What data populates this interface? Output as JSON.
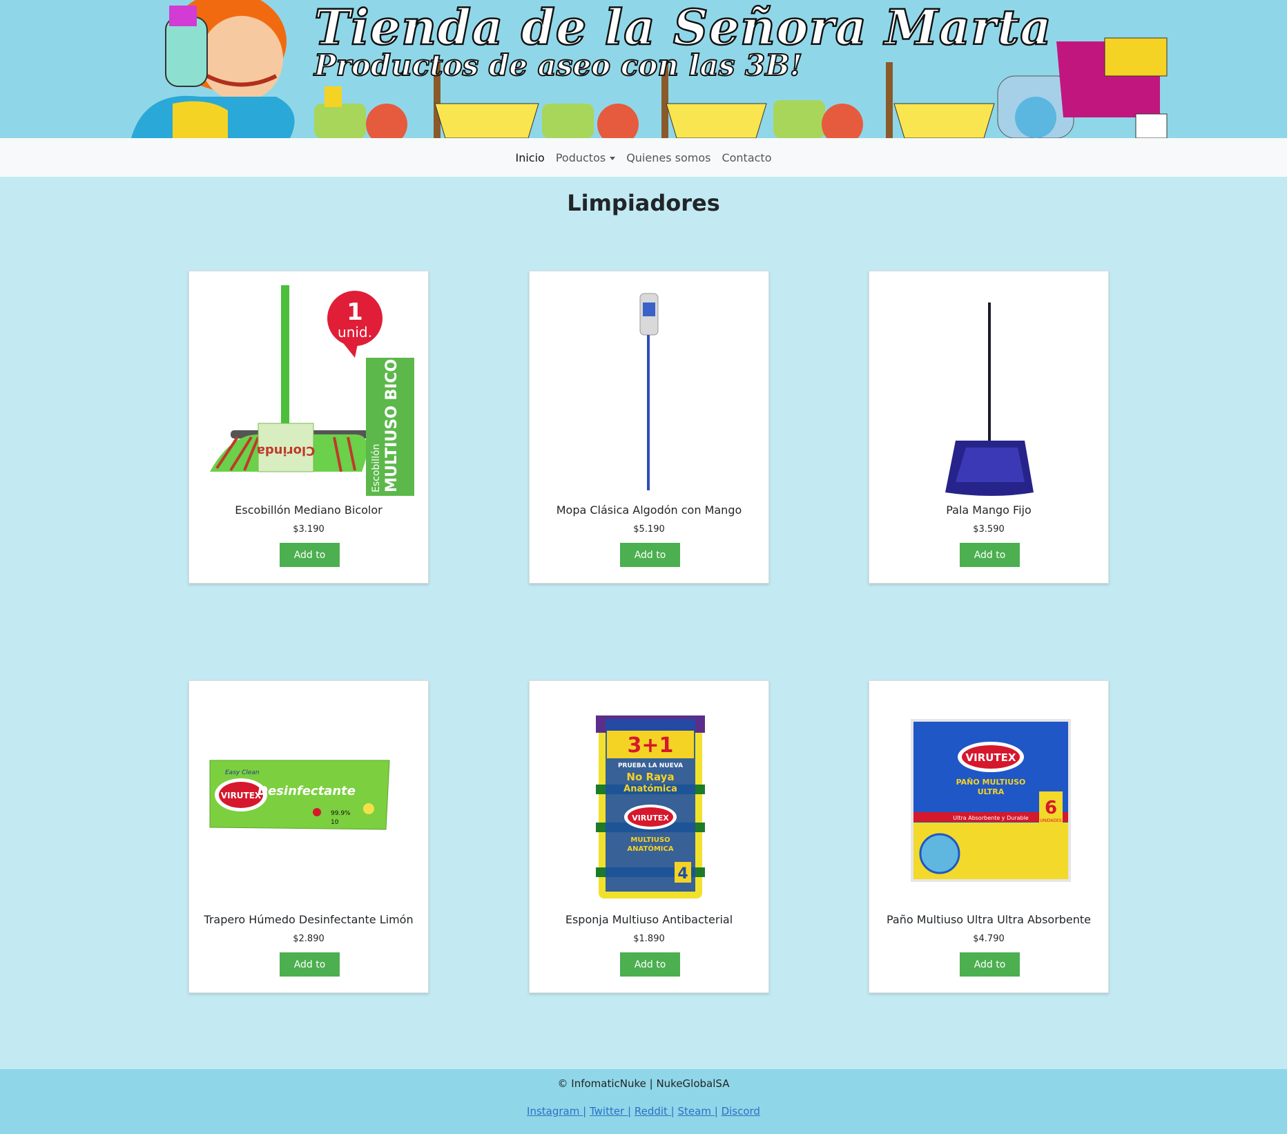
{
  "banner": {
    "title": "Tienda de la Señora Marta",
    "subtitle": "Productos de aseo con las 3B!"
  },
  "nav": {
    "items": [
      {
        "label": "Inicio",
        "active": true
      },
      {
        "label": "Poductos",
        "dropdown": true
      },
      {
        "label": "Quienes somos"
      },
      {
        "label": "Contacto"
      }
    ]
  },
  "page": {
    "title": "Limpiadores"
  },
  "products": [
    {
      "name": "Escobillón Mediano Bicolor",
      "price": "$3.190",
      "button": "Add to Cart",
      "image_text": {
        "badge_num": "1",
        "badge_unit": "unid.",
        "side_big": "MULTIUSO BICOLOR",
        "side_small": "Escobillón",
        "brand": "Clorinda"
      }
    },
    {
      "name": "Mopa Clásica Algodón con Mango",
      "price": "$5.190",
      "button": "Add to Cart"
    },
    {
      "name": "Pala Mango Fijo",
      "price": "$3.590",
      "button": "Add to Cart"
    },
    {
      "name": "Trapero Húmedo Desinfectante Limón",
      "price": "$2.890",
      "button": "Add to Cart",
      "image_text": {
        "brand": "VIRUTEX",
        "tag": "Easy Clean",
        "product": "Desinfectante",
        "pct": "99.9%",
        "count": "10"
      }
    },
    {
      "name": "Esponja Multiuso Antibacterial",
      "price": "$1.890",
      "button": "Add to Cart",
      "image_text": {
        "promo": "3+1",
        "line1": "PRUEBA LA NUEVA",
        "line2": "No Raya",
        "line3": "Anatómica",
        "brand": "VIRUTEX",
        "desc1": "MULTIUSO",
        "desc2": "ANATÓMICA",
        "count": "4"
      }
    },
    {
      "name": "Paño Multiuso Ultra Ultra Absorbente",
      "price": "$4.790",
      "button": "Add to Cart",
      "image_text": {
        "brand": "VIRUTEX",
        "desc1": "PAÑO MULTIUSO",
        "desc2": "ULTRA",
        "strip": "Ultra Absorbente y Durable",
        "count": "6",
        "unit": "UNIDADES"
      }
    }
  ],
  "footer": {
    "copyright": "© InfomaticNuke | NukeGlobalSA",
    "links": [
      "Instagram |",
      "Twitter |",
      "Reddit |",
      "Steam |",
      "Discord"
    ]
  },
  "colors": {
    "background": "#c3eaf2",
    "banner": "#8fd7e8",
    "button": "#4caf50",
    "link": "#2d6fc7"
  }
}
